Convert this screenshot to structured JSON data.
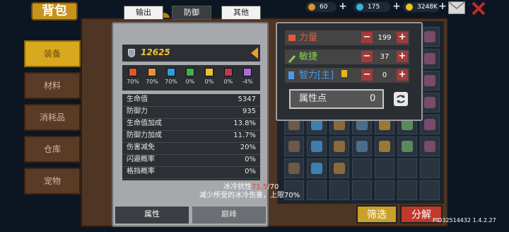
{
  "header": {
    "title": "背包"
  },
  "resources": [
    {
      "icon": "meat-icon",
      "value": "60",
      "color": "#e0902a"
    },
    {
      "icon": "gem-icon",
      "value": "175",
      "color": "#3ab0e8"
    },
    {
      "icon": "gold-coin-icon",
      "value": "3248K",
      "color": "#f2c21c"
    }
  ],
  "tabs": [
    "装备",
    "材料",
    "消耗品",
    "仓库",
    "宠物"
  ],
  "stats_panel": {
    "categories": [
      "输出",
      "防御",
      "其他"
    ],
    "power": "12625",
    "resists": [
      {
        "color": "#e2572a",
        "value": "70%"
      },
      {
        "color": "#e8913a",
        "value": "70%"
      },
      {
        "color": "#2e9ee0",
        "value": "70%"
      },
      {
        "color": "#3bb24b",
        "value": "0%"
      },
      {
        "color": "#e8c42a",
        "value": "0%"
      },
      {
        "color": "#c23a4a",
        "value": "0%"
      },
      {
        "color": "#b06ad8",
        "value": "-4%"
      }
    ],
    "rows": [
      {
        "k": "生命值",
        "v": "5347"
      },
      {
        "k": "防御力",
        "v": "935"
      },
      {
        "k": "生命值加成",
        "v": "13.8%"
      },
      {
        "k": "防御力加成",
        "v": "11.7%"
      },
      {
        "k": "伤害减免",
        "v": "20%"
      },
      {
        "k": "闪避概率",
        "v": "0%"
      },
      {
        "k": "格挡概率",
        "v": "0%"
      }
    ],
    "tooltip": {
      "name": "冰冷抗性",
      "current": "71.5",
      "sep": "/",
      "max": "70",
      "desc": "减少所受的冰冷伤害，上限70%"
    },
    "subtabs": [
      "属性",
      "巅峰"
    ]
  },
  "attributes": [
    {
      "name": "力量",
      "value": "199",
      "color": "#e05a3a"
    },
    {
      "name": "敏捷",
      "value": "37",
      "color": "#8ad04a"
    },
    {
      "name": "智力[主]",
      "value": "0",
      "color": "#4a9ce8"
    }
  ],
  "attr_points": {
    "label": "属性点",
    "value": "0"
  },
  "buttons": {
    "filter": "筛选",
    "decompose": "分解"
  },
  "version": "PID32514432 1.4.2.27"
}
